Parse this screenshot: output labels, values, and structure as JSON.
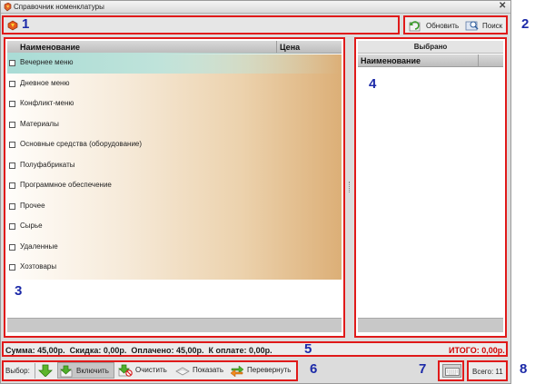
{
  "window": {
    "title": "Справочник номенклатуры"
  },
  "toolbar": {
    "refresh_label": "Обновить",
    "search_label": "Поиск"
  },
  "catalog": {
    "columns": [
      "Наименование",
      "Цена"
    ],
    "items": [
      "Вечернее меню",
      "Дневное меню",
      "Конфликт-меню",
      "Материалы",
      "Основные средства (оборудование)",
      "Полуфабрикаты",
      "Программное обеспечение",
      "Прочее",
      "Сырье",
      "Удаленные",
      "Хозтовары"
    ]
  },
  "selected_panel": {
    "title": "Выбрано",
    "column": "Наименование"
  },
  "summary": {
    "text": "Сумма: 45,00р.  Скидка: 0,00р.  Оплачено: 45,00р.  К оплате: 0,00р.",
    "total": "ИТОГО: 0,00р."
  },
  "selection_bar": {
    "label": "Выбор:",
    "include_label": "Включить",
    "clear_label": "Очистить",
    "show_label": "Показать",
    "invert_label": "Перевернуть"
  },
  "status": {
    "count_label": "Всего: 11"
  },
  "callouts": [
    "1",
    "2",
    "3",
    "4",
    "5",
    "6",
    "7",
    "8"
  ],
  "colors": {
    "callout_border": "#e01a1a",
    "callout_number": "#1c2aa8",
    "total_text": "#d10000",
    "selected_row": "#a9dcd6"
  }
}
